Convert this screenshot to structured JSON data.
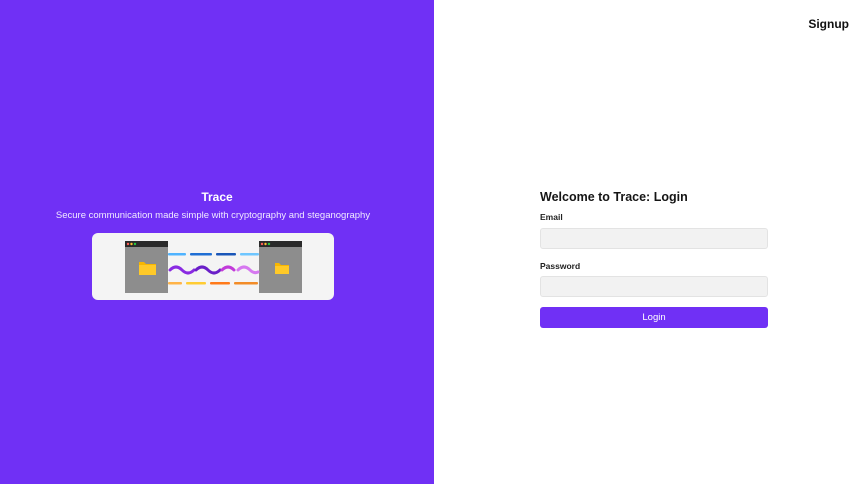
{
  "brand": {
    "title": "Trace",
    "subtitle": "Secure communication made simple with cryptography and steganography"
  },
  "nav": {
    "signup_label": "Signup"
  },
  "form": {
    "title": "Welcome to Trace: Login",
    "email_label": "Email",
    "email_value": "",
    "password_label": "Password",
    "password_value": "",
    "submit_label": "Login"
  },
  "illustration": {
    "icons": [
      "window-icon",
      "folder-icon",
      "window-icon",
      "folder-icon"
    ]
  },
  "colors": {
    "accent": "#7030f5",
    "panel": "#f4f4f4",
    "folder": "#f7b600"
  }
}
